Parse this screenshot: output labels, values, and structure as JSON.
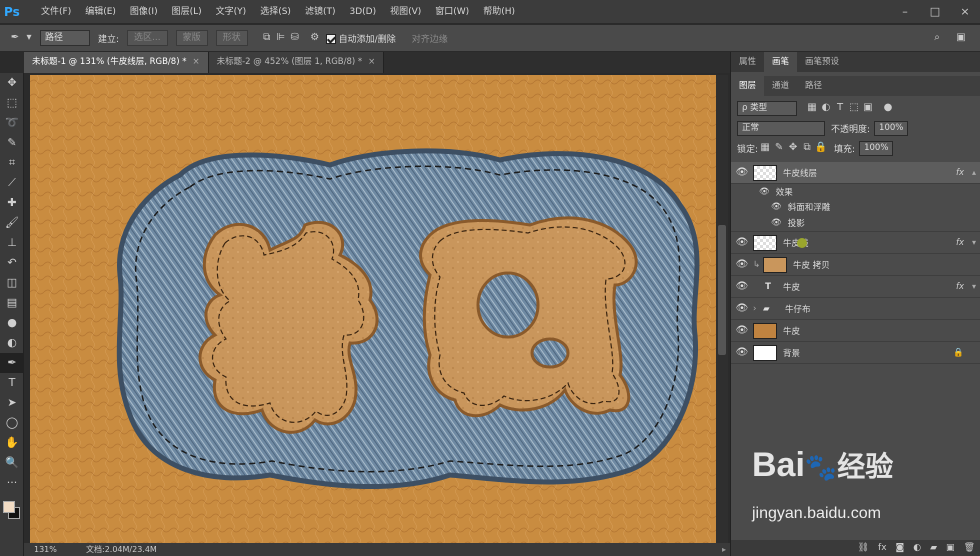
{
  "app": {
    "logo": "Ps",
    "menu": [
      "文件(F)",
      "编辑(E)",
      "图像(I)",
      "图层(L)",
      "文字(Y)",
      "选择(S)",
      "滤镜(T)",
      "3D(D)",
      "视图(V)",
      "窗口(W)",
      "帮助(H)"
    ]
  },
  "options": {
    "mode": "路径",
    "make_label": "建立:",
    "selection_btn": "选区...",
    "mask_btn": "蒙版",
    "shape_btn": "形状",
    "auto_add": "自动添加/删除",
    "align_edges": "对齐边缘"
  },
  "tabs": [
    {
      "label": "未标题-1 @ 131% (牛皮线层, RGB/8) *",
      "close": "×"
    },
    {
      "label": "未标题-2 @ 452% (图层 1, RGB/8) *",
      "close": "×"
    }
  ],
  "status": {
    "zoom": "131%",
    "doc": "文档:2.04M/23.4M"
  },
  "panel": {
    "top_tabs": [
      "属性",
      "画笔",
      "画笔预设"
    ],
    "layer_tabs": [
      "图层",
      "通道",
      "路径"
    ],
    "filter": "ρ 类型",
    "blend": "正常",
    "opacity_label": "不透明度:",
    "opacity": "100%",
    "lock_label": "锁定:",
    "fill_label": "填充:",
    "fill": "100%",
    "layers": [
      {
        "name": "牛皮线层",
        "fx": "fx"
      },
      {
        "name": "牛皮线",
        "fx": "fx"
      },
      {
        "name": "牛皮 拷贝"
      },
      {
        "name": "牛皮",
        "fx": "fx"
      },
      {
        "name": "牛仔布"
      },
      {
        "name": "牛皮"
      },
      {
        "name": "背景"
      }
    ],
    "effects_label": "效果",
    "effects": [
      "斜面和浮雕",
      "投影"
    ]
  },
  "canvas_text": {
    "char1": "牛",
    "char2": "皮"
  },
  "watermark": {
    "brand_a": "Bai",
    "brand_b": "经验",
    "url": "jingyan.baidu.com"
  }
}
